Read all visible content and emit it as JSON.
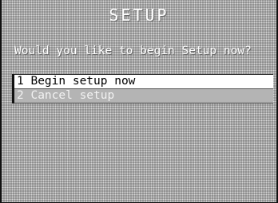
{
  "screen": {
    "title": "SETUP",
    "prompt": "Would you like to begin Setup now?"
  },
  "menu": {
    "items": [
      {
        "label": "1 Begin setup now",
        "selected": true
      },
      {
        "label": "2 Cancel setup",
        "selected": false
      }
    ]
  }
}
